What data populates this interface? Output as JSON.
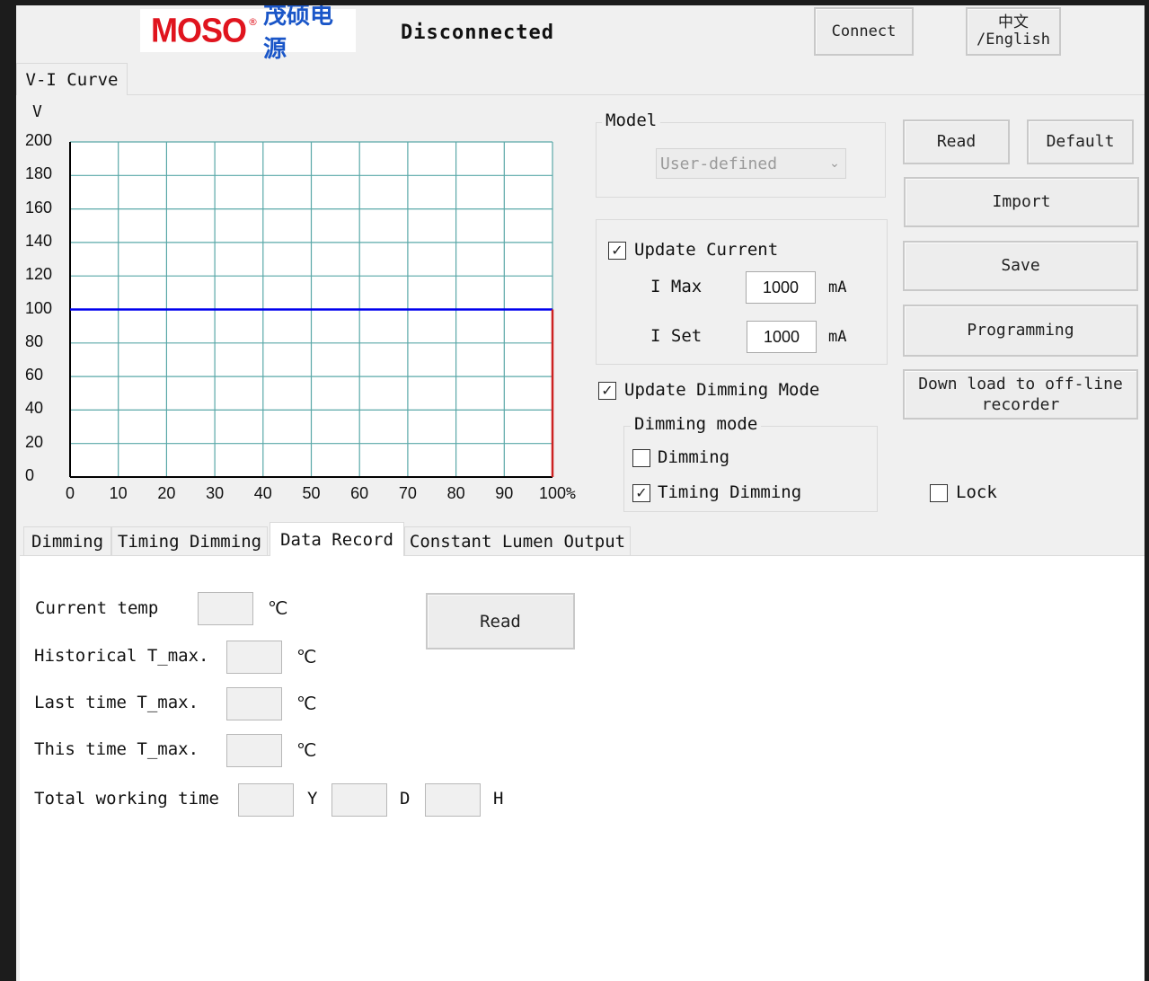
{
  "header": {
    "logo_brand": "MOSO",
    "logo_reg": "®",
    "logo_cn": "茂硕电源",
    "status": "Disconnected",
    "connect_label": "Connect",
    "lang_label_cn": "中文",
    "lang_label_en": "/English"
  },
  "top_tab": "V-I Curve",
  "chart_data": {
    "type": "line",
    "ylabel": "V",
    "x_unit": "%",
    "xlim": [
      0,
      100
    ],
    "ylim": [
      0,
      200
    ],
    "x_ticks": [
      "0",
      "10",
      "20",
      "30",
      "40",
      "50",
      "60",
      "70",
      "80",
      "90",
      "100"
    ],
    "y_ticks": [
      "200",
      "180",
      "160",
      "140",
      "120",
      "100",
      "80",
      "60",
      "40",
      "20",
      "0"
    ],
    "grid": true,
    "series": [
      {
        "color": "#0000ee",
        "points": [
          [
            0,
            100
          ],
          [
            100,
            100
          ]
        ]
      },
      {
        "color": "#cc2222",
        "points": [
          [
            100,
            0
          ],
          [
            100,
            100
          ]
        ]
      }
    ]
  },
  "model": {
    "group_title": "Model",
    "select_value": "User-defined"
  },
  "current": {
    "update_label": "Update Current",
    "update_checked": true,
    "imax_label": "I Max",
    "imax_value": "1000",
    "imax_unit": "mA",
    "iset_label": "I Set",
    "iset_value": "1000",
    "iset_unit": "mA"
  },
  "dimming": {
    "update_label": "Update Dimming Mode",
    "update_checked": true,
    "group_title": "Dimming mode",
    "dimming_label": "Dimming",
    "dimming_checked": false,
    "timing_label": "Timing Dimming",
    "timing_checked": true
  },
  "buttons": {
    "read": "Read",
    "default": "Default",
    "import": "Import",
    "save": "Save",
    "programming": "Programming",
    "download_line1": "Down load to off-line",
    "download_line2": "recorder"
  },
  "lock": {
    "label": "Lock",
    "checked": false
  },
  "tabs": [
    {
      "label": "Dimming"
    },
    {
      "label": "Timing Dimming"
    },
    {
      "label": "Data Record"
    },
    {
      "label": "Constant Lumen Output"
    }
  ],
  "data_record": {
    "current_temp_label": "Current temp",
    "historical_label": "Historical T_max.",
    "last_label": "Last time T_max.",
    "this_label": "This time T_max.",
    "total_label": "Total working time",
    "temp_unit": "℃",
    "year_unit": "Y",
    "day_unit": "D",
    "hour_unit": "H",
    "read_label": "Read"
  }
}
